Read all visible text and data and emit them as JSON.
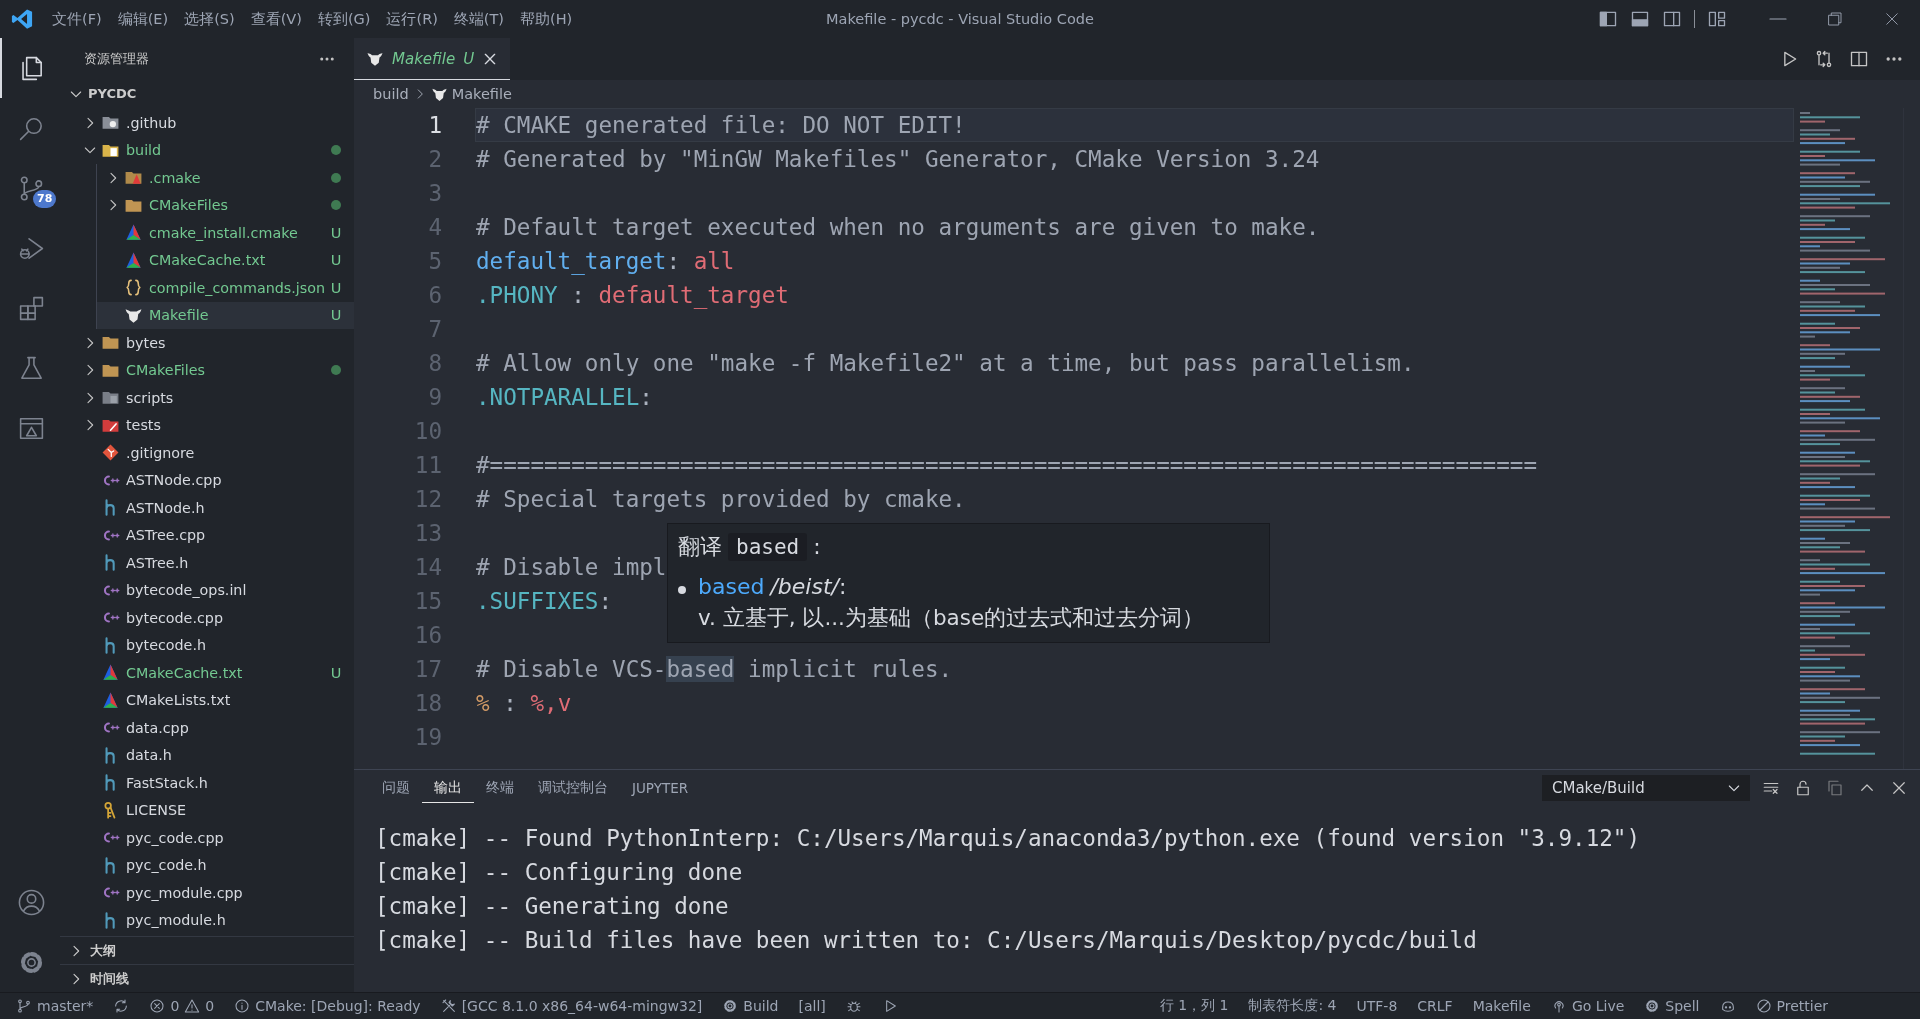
{
  "title_bar": {
    "menus": [
      "文件(F)",
      "编辑(E)",
      "选择(S)",
      "查看(V)",
      "转到(G)",
      "运行(R)",
      "终端(T)",
      "帮助(H)"
    ],
    "title": "Makefile - pycdc - Visual Studio Code"
  },
  "activity_bar": {
    "items": [
      {
        "kind": "explorer",
        "selected": true
      },
      {
        "kind": "search",
        "selected": false
      },
      {
        "kind": "source-control",
        "selected": false,
        "badge": "78"
      },
      {
        "kind": "run-debug",
        "selected": false
      },
      {
        "kind": "extensions",
        "selected": false
      },
      {
        "kind": "testing",
        "selected": false
      },
      {
        "kind": "remote",
        "selected": false
      }
    ],
    "bottom": [
      {
        "kind": "account"
      },
      {
        "kind": "settings"
      }
    ]
  },
  "sidebar": {
    "title": "资源管理器",
    "root": {
      "label": "PYCDC",
      "expanded": true
    },
    "tree": [
      {
        "label": ".github",
        "kind": "github-folder",
        "expanded": false,
        "untracked": false,
        "dot": false,
        "selected": false
      },
      {
        "label": "build",
        "kind": "build-folder",
        "expanded": true,
        "untracked": true,
        "dot": true,
        "selected": false,
        "children": [
          {
            "label": ".cmake",
            "kind": "cmake-folder",
            "expanded": false,
            "untracked": true,
            "dot": true,
            "selected": false
          },
          {
            "label": "CMakeFiles",
            "kind": "folder",
            "expanded": false,
            "untracked": true,
            "dot": true,
            "selected": false
          },
          {
            "label": "cmake_install.cmake",
            "kind": "cmake-file",
            "untracked": true,
            "dot": false,
            "badge": "U",
            "selected": false
          },
          {
            "label": "CMakeCache.txt",
            "kind": "cmake-file",
            "untracked": true,
            "dot": false,
            "badge": "U",
            "selected": false
          },
          {
            "label": "compile_commands.json",
            "kind": "json-file",
            "untracked": true,
            "dot": false,
            "badge": "U",
            "selected": false
          },
          {
            "label": "Makefile",
            "kind": "makefile",
            "untracked": true,
            "dot": false,
            "badge": "U",
            "selected": true
          }
        ]
      },
      {
        "label": "bytes",
        "kind": "folder",
        "expanded": false,
        "untracked": false,
        "dot": false,
        "selected": false
      },
      {
        "label": "CMakeFiles",
        "kind": "folder",
        "expanded": false,
        "untracked": true,
        "dot": true,
        "selected": false
      },
      {
        "label": "scripts",
        "kind": "scripts-folder",
        "expanded": false,
        "untracked": false,
        "dot": false,
        "selected": false
      },
      {
        "label": "tests",
        "kind": "tests-folder",
        "expanded": false,
        "untracked": false,
        "dot": false,
        "selected": false
      },
      {
        "label": ".gitignore",
        "kind": "git-file",
        "untracked": false,
        "dot": false,
        "selected": false
      },
      {
        "label": "ASTNode.cpp",
        "kind": "cpp-file",
        "untracked": false,
        "dot": false,
        "selected": false
      },
      {
        "label": "ASTNode.h",
        "kind": "header-file",
        "untracked": false,
        "dot": false,
        "selected": false
      },
      {
        "label": "ASTree.cpp",
        "kind": "cpp-file",
        "untracked": false,
        "dot": false,
        "selected": false
      },
      {
        "label": "ASTree.h",
        "kind": "header-file",
        "untracked": false,
        "dot": false,
        "selected": false
      },
      {
        "label": "bytecode_ops.inl",
        "kind": "cpp-file",
        "untracked": false,
        "dot": false,
        "selected": false
      },
      {
        "label": "bytecode.cpp",
        "kind": "cpp-file",
        "untracked": false,
        "dot": false,
        "selected": false
      },
      {
        "label": "bytecode.h",
        "kind": "header-file",
        "untracked": false,
        "dot": false,
        "selected": false
      },
      {
        "label": "CMakeCache.txt",
        "kind": "cmake-file",
        "untracked": true,
        "dot": false,
        "badge": "U",
        "selected": false
      },
      {
        "label": "CMakeLists.txt",
        "kind": "cmake-file",
        "untracked": false,
        "dot": false,
        "selected": false
      },
      {
        "label": "data.cpp",
        "kind": "cpp-file",
        "untracked": false,
        "dot": false,
        "selected": false
      },
      {
        "label": "data.h",
        "kind": "header-file",
        "untracked": false,
        "dot": false,
        "selected": false
      },
      {
        "label": "FastStack.h",
        "kind": "header-file",
        "untracked": false,
        "dot": false,
        "selected": false
      },
      {
        "label": "LICENSE",
        "kind": "license-file",
        "untracked": false,
        "dot": false,
        "selected": false
      },
      {
        "label": "pyc_code.cpp",
        "kind": "cpp-file",
        "untracked": false,
        "dot": false,
        "selected": false
      },
      {
        "label": "pyc_code.h",
        "kind": "header-file",
        "untracked": false,
        "dot": false,
        "selected": false
      },
      {
        "label": "pyc_module.cpp",
        "kind": "cpp-file",
        "untracked": false,
        "dot": false,
        "selected": false
      },
      {
        "label": "pyc_module.h",
        "kind": "header-file",
        "untracked": false,
        "dot": false,
        "selected": false
      }
    ],
    "sections": [
      {
        "label": "大纲",
        "expanded": false
      },
      {
        "label": "时间线",
        "expanded": false
      }
    ]
  },
  "editor": {
    "tabs": [
      {
        "label": "Makefile",
        "kind": "makefile",
        "status": "U",
        "preview": true,
        "selected": true
      }
    ],
    "breadcrumb": [
      {
        "label": "build",
        "kind": "directory"
      },
      {
        "label": "Makefile",
        "kind": "makefile"
      }
    ],
    "lines": [
      {
        "number": "1",
        "current": true,
        "tokens": [
          {
            "text": "# CMAKE generated file: DO NOT EDIT!",
            "kind": "comment"
          }
        ]
      },
      {
        "number": "2",
        "current": false,
        "tokens": [
          {
            "text": "# Generated by \"MinGW Makefiles\" Generator, CMake Version 3.24",
            "kind": "comment"
          }
        ]
      },
      {
        "number": "3",
        "current": false
      },
      {
        "number": "4",
        "current": false,
        "tokens": [
          {
            "text": "# Default target executed when no arguments are given to make.",
            "kind": "comment"
          }
        ]
      },
      {
        "number": "5",
        "current": false,
        "tokens": [
          {
            "text": "default_target",
            "kind": "target"
          },
          {
            "text": ": ",
            "kind": "plain"
          },
          {
            "text": "all",
            "kind": "value"
          }
        ]
      },
      {
        "number": "6",
        "current": false,
        "tokens": [
          {
            "text": ".PHONY",
            "kind": "special"
          },
          {
            "text": " : ",
            "kind": "plain"
          },
          {
            "text": "default_target",
            "kind": "value"
          }
        ]
      },
      {
        "number": "7",
        "current": false
      },
      {
        "number": "8",
        "current": false,
        "tokens": [
          {
            "text": "# Allow only one \"make -f Makefile2\" at a time, but pass parallelism.",
            "kind": "comment"
          }
        ]
      },
      {
        "number": "9",
        "current": false,
        "tokens": [
          {
            "text": ".NOTPARALLEL",
            "kind": "special"
          },
          {
            "text": ":",
            "kind": "plain"
          }
        ]
      },
      {
        "number": "10",
        "current": false
      },
      {
        "number": "11",
        "current": false,
        "tokens": [
          {
            "text": "#=============================================================================",
            "kind": "comment"
          }
        ]
      },
      {
        "number": "12",
        "current": false,
        "tokens": [
          {
            "text": "# Special targets provided by cmake.",
            "kind": "comment"
          }
        ]
      },
      {
        "number": "13",
        "current": false
      },
      {
        "number": "14",
        "current": false,
        "tokens": [
          {
            "text": "# Disable impl",
            "kind": "comment"
          }
        ]
      },
      {
        "number": "15",
        "current": false,
        "tokens": [
          {
            "text": ".SUFFIXES",
            "kind": "special"
          },
          {
            "text": ":",
            "kind": "plain"
          }
        ]
      },
      {
        "number": "16",
        "current": false
      },
      {
        "number": "17",
        "current": false,
        "tokens": [
          {
            "text": "# Disable VCS-",
            "kind": "comment"
          },
          {
            "text": "based",
            "kind": "match"
          },
          {
            "text": " implicit rules.",
            "kind": "comment"
          }
        ]
      },
      {
        "number": "18",
        "current": false,
        "tokens": [
          {
            "text": "%",
            "kind": "operator"
          },
          {
            "text": " : ",
            "kind": "plain"
          },
          {
            "text": "%,v",
            "kind": "value"
          }
        ]
      },
      {
        "number": "19",
        "current": false
      }
    ],
    "tooltip": {
      "title": "翻译",
      "term": "based",
      "title_end": ":",
      "entries": [
        {
          "word": "based",
          "phonetic": "*/beist/*:",
          "definition": "v. 立基于, 以...为基础（base的过去式和过去分词）"
        }
      ]
    }
  },
  "panel": {
    "tabs": [
      {
        "label": "问题",
        "selected": false
      },
      {
        "label": "输出",
        "selected": true
      },
      {
        "label": "终端",
        "selected": false
      },
      {
        "label": "调试控制台",
        "selected": false
      },
      {
        "label": "JUPYTER",
        "selected": false
      }
    ],
    "channel": "CMake/Build",
    "lines": [
      "[cmake] -- Found PythonInterp: C:/Users/Marquis/anaconda3/python.exe (found version \"3.9.12\")",
      "[cmake] -- Configuring done",
      "[cmake] -- Generating done",
      "[cmake] -- Build files have been written to: C:/Users/Marquis/Desktop/pycdc/build"
    ]
  },
  "status_bar": {
    "left": [
      {
        "kind": "branch",
        "text": "master*"
      },
      {
        "kind": "sync"
      },
      {
        "kind": "problems",
        "errors": "0",
        "warnings": "0"
      },
      {
        "kind": "info",
        "text": "CMake: [Debug]: Ready"
      },
      {
        "kind": "tools",
        "text": "[GCC 8.1.0 x86_64-w64-mingw32]"
      },
      {
        "kind": "gear",
        "text": "Build"
      },
      {
        "kind": "plain",
        "text": "[all]"
      },
      {
        "kind": "debug"
      },
      {
        "kind": "run"
      }
    ],
    "right": [
      {
        "kind": "plain",
        "text": "行 1，列 1"
      },
      {
        "kind": "plain",
        "text": "制表符长度: 4"
      },
      {
        "kind": "plain",
        "text": "UTF-8"
      },
      {
        "kind": "plain",
        "text": "CRLF"
      },
      {
        "kind": "plain",
        "text": "Makefile"
      },
      {
        "kind": "broadcast",
        "text": "Go Live"
      },
      {
        "kind": "gear",
        "text": "Spell"
      },
      {
        "kind": "copilot"
      },
      {
        "kind": "prettier",
        "text": "Prettier"
      }
    ]
  }
}
